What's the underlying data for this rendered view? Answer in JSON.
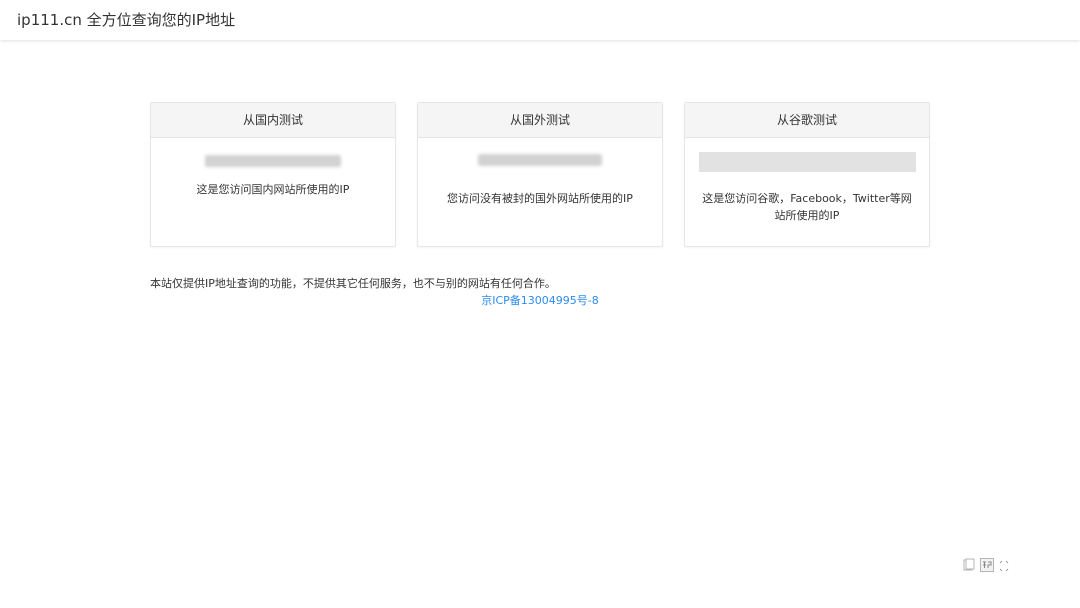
{
  "header": {
    "title": "ip111.cn 全方位查询您的IP地址"
  },
  "cards": [
    {
      "title": "从国内测试",
      "desc": "这是您访问国内网站所使用的IP"
    },
    {
      "title": "从国外测试",
      "desc": "您访问没有被封的国外网站所使用的IP"
    },
    {
      "title": "从谷歌测试",
      "desc": "这是您访问谷歌，Facebook，Twitter等网站所使用的IP"
    }
  ],
  "footer": {
    "disclaimer": "本站仅提供IP地址查询的功能，不提供其它任何服务，也不与别的网站有任何合作。",
    "icp": "京ICP备13004995号-8"
  },
  "floating_icons": [
    "clipboard-icon",
    "ime-pinyin-icon",
    "expand-icon"
  ],
  "colors": {
    "link": "#2d8cf0",
    "card_header_bg": "#f5f5f5",
    "border": "#e6e6e6"
  }
}
